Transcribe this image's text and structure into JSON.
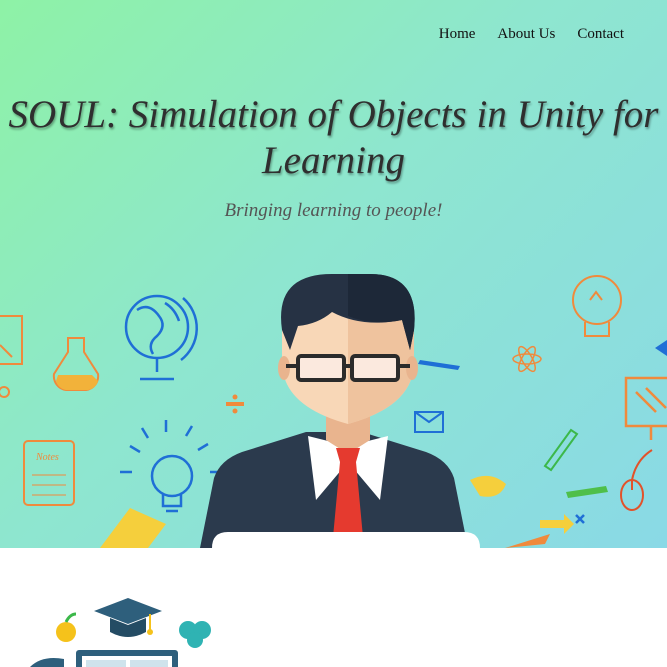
{
  "nav": {
    "items": [
      {
        "label": "Home"
      },
      {
        "label": "About Us"
      },
      {
        "label": "Contact"
      }
    ]
  },
  "hero": {
    "title": "SOUL: Simulation of Objects in Unity for Learning",
    "tagline": "Bringing learning to people!",
    "notebook_text": "Notes"
  },
  "colors": {
    "gradient_start": "#8ef2a6",
    "gradient_end": "#8ad9e6",
    "suit": "#2b3a4d",
    "tie": "#e53a2f",
    "hair": "#263244"
  },
  "icons": [
    "globe-icon",
    "flask-icon",
    "lightbulb-icon",
    "notebook-icon",
    "atom-icon",
    "pencil-icon",
    "envelope-icon",
    "computer-icon",
    "mouse-icon",
    "ruler-icon",
    "graduation-cap-icon",
    "brain-icon",
    "apple-icon"
  ]
}
